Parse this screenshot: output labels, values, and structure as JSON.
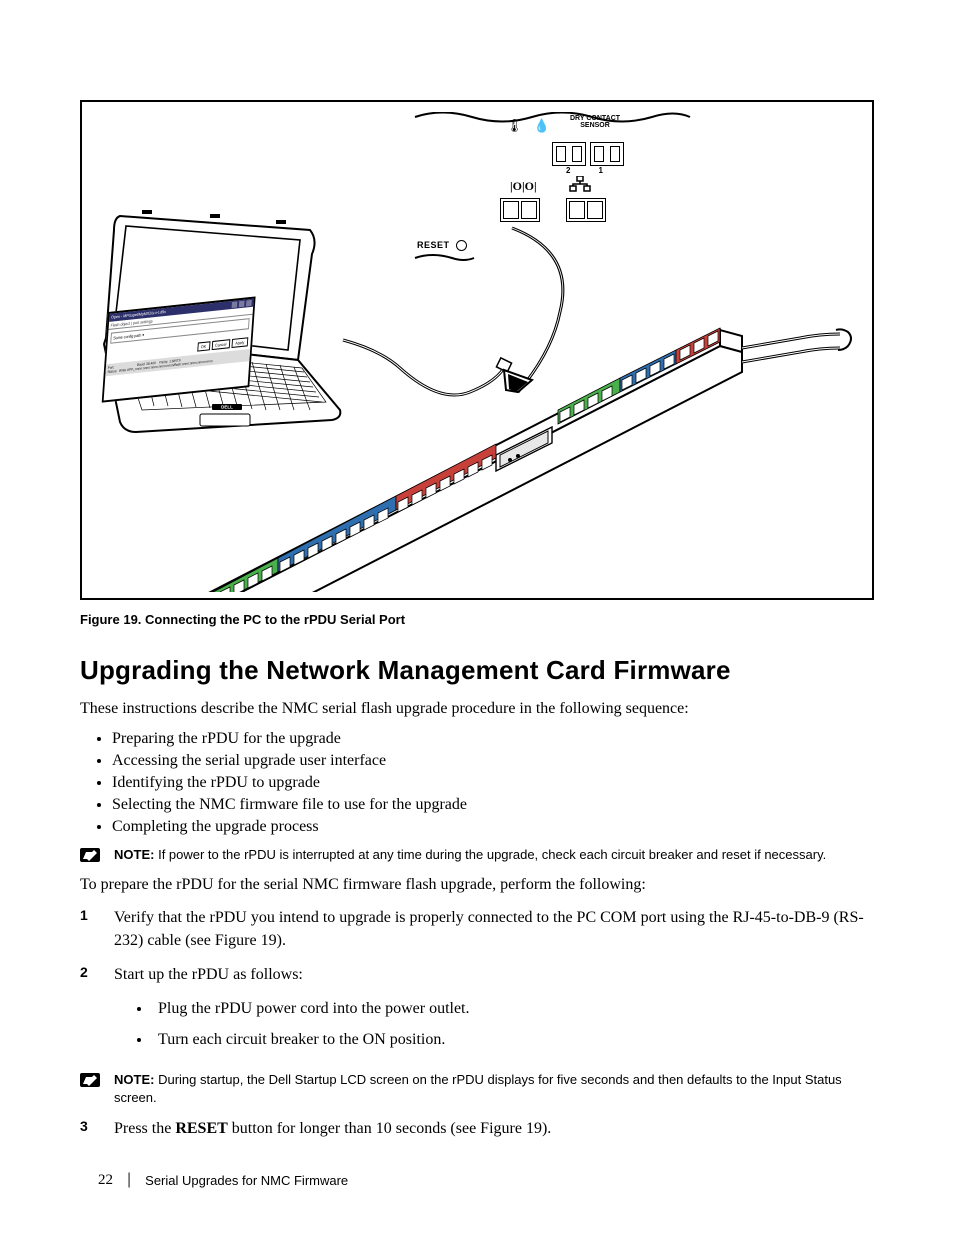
{
  "diagram": {
    "labels": {
      "dry_contact_line1": "DRY CONTACT",
      "dry_contact_line2": "SENSOR",
      "dry_contact_2": "2",
      "dry_contact_1": "1",
      "midglyph": "|O|O|",
      "reset": "RESET",
      "screen_title": "Open - MPUspel/MpMX2/s-x-t.d9x"
    }
  },
  "caption": "Figure 19. Connecting the PC to the rPDU Serial Port",
  "section_title": "Upgrading the Network Management Card Firmware",
  "intro": "These instructions describe the NMC serial flash upgrade procedure in the following sequence:",
  "bullets": [
    "Preparing the rPDU for the upgrade",
    "Accessing the serial upgrade user interface",
    "Identifying the rPDU to upgrade",
    "Selecting the  NMC firmware file to use for the upgrade",
    "Completing the upgrade process"
  ],
  "note1": {
    "label": "NOTE:",
    "text": "If power to the rPDU is interrupted at any time during the upgrade, check each circuit breaker and reset if necessary."
  },
  "prepare": "To prepare the rPDU for the serial NMC firmware flash upgrade, perform the following:",
  "steps": {
    "1": "Verify that the rPDU you intend to upgrade is properly connected to the PC COM port using the RJ-45-to-DB-9 (RS-232) cable (see Figure 19).",
    "2": {
      "lead": "Start up the rPDU as follows:",
      "subs": [
        "Plug the rPDU power cord into the power outlet.",
        "Turn each circuit breaker to the ON position."
      ]
    },
    "3": {
      "pre": "Press the ",
      "bold": "RESET",
      "post": " button for longer than 10 seconds (see Figure 19)."
    }
  },
  "note2": {
    "label": "NOTE:",
    "text": "During startup, the Dell Startup LCD screen on the rPDU displays for five seconds and then defaults to the Input Status screen."
  },
  "footer": {
    "page": "22",
    "title": "Serial Upgrades for NMC Firmware"
  }
}
